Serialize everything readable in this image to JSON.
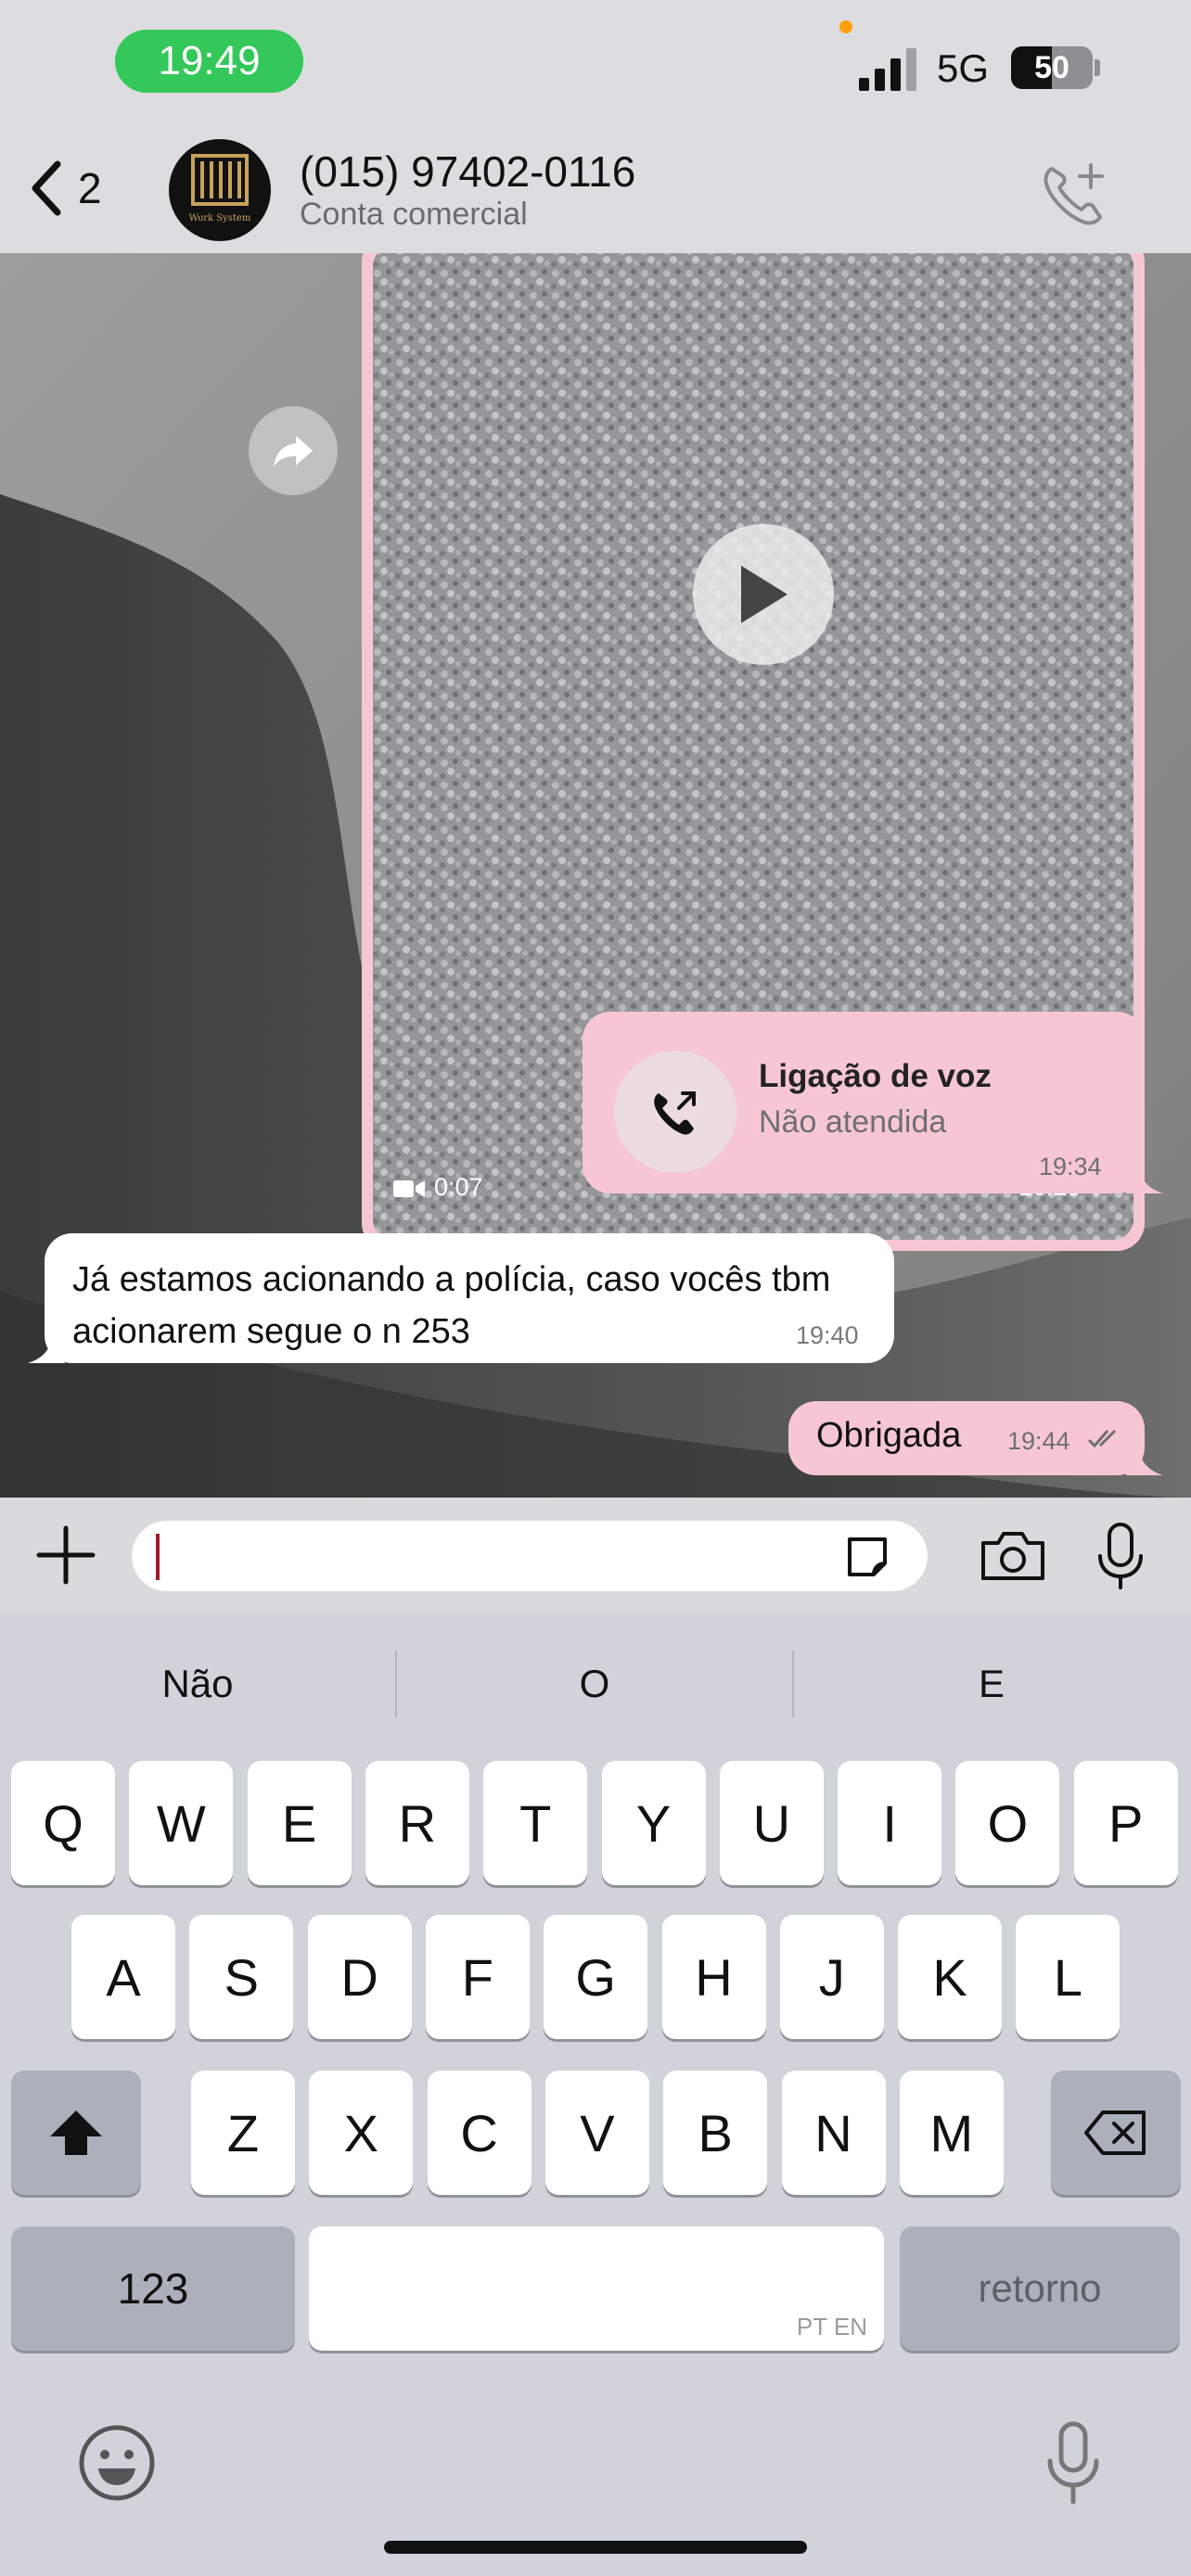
{
  "status_bar": {
    "time": "19:49",
    "network": "5G",
    "battery": "50",
    "battery_level_pct": 50
  },
  "header": {
    "back_count": "2",
    "contact_name": "(015) 97402-0116",
    "contact_subtitle": "Conta comercial",
    "avatar_label": "Work System",
    "call_icon": "phone-plus-icon"
  },
  "messages": {
    "video": {
      "duration": "0:07",
      "time": "16:29"
    },
    "voice_call": {
      "title": "Ligação de voz",
      "status": "Não atendida",
      "time": "19:34"
    },
    "incoming": {
      "text": "Já estamos acionando a polícia, caso vocês tbm acionarem segue o n 253",
      "time": "19:40"
    },
    "outgoing": {
      "text": "Obrigada",
      "time": "19:44"
    }
  },
  "keyboard": {
    "suggestions": [
      "Não",
      "O",
      "E"
    ],
    "row1": [
      "Q",
      "W",
      "E",
      "R",
      "T",
      "Y",
      "U",
      "I",
      "O",
      "P"
    ],
    "row2": [
      "A",
      "S",
      "D",
      "F",
      "G",
      "H",
      "J",
      "K",
      "L"
    ],
    "row3": [
      "Z",
      "X",
      "C",
      "V",
      "B",
      "N",
      "M"
    ],
    "numbers_label": "123",
    "space_lang": "PT EN",
    "return_label": "retorno"
  },
  "colors": {
    "outgoing_bubble": "#f6c7d2",
    "incoming_bubble": "#ffffff",
    "clock_pill": "#34c759"
  }
}
